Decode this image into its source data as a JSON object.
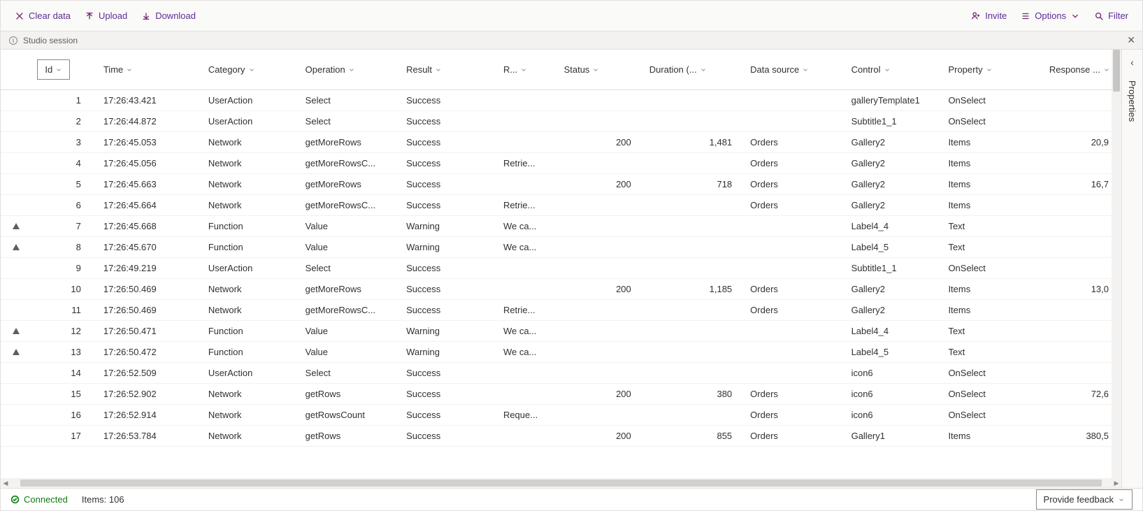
{
  "toolbar": {
    "clear": "Clear data",
    "upload": "Upload",
    "download": "Download",
    "invite": "Invite",
    "options": "Options",
    "filter": "Filter"
  },
  "infobar": {
    "text": "Studio session"
  },
  "sidepanel": {
    "label": "Properties"
  },
  "statusbar": {
    "connected": "Connected",
    "items": "Items: 106",
    "feedback": "Provide feedback"
  },
  "columns": {
    "id": "Id",
    "time": "Time",
    "category": "Category",
    "operation": "Operation",
    "result": "Result",
    "r": "R...",
    "status": "Status",
    "duration": "Duration (...",
    "datasource": "Data source",
    "control": "Control",
    "property": "Property",
    "response": "Response ..."
  },
  "rows": [
    {
      "warn": false,
      "id": "1",
      "time": "17:26:43.421",
      "cat": "UserAction",
      "op": "Select",
      "res": "Success",
      "r": "",
      "status": "",
      "dur": "",
      "ds": "",
      "ctrl": "galleryTemplate1",
      "prop": "OnSelect",
      "resp": ""
    },
    {
      "warn": false,
      "id": "2",
      "time": "17:26:44.872",
      "cat": "UserAction",
      "op": "Select",
      "res": "Success",
      "r": "",
      "status": "",
      "dur": "",
      "ds": "",
      "ctrl": "Subtitle1_1",
      "prop": "OnSelect",
      "resp": ""
    },
    {
      "warn": false,
      "id": "3",
      "time": "17:26:45.053",
      "cat": "Network",
      "op": "getMoreRows",
      "res": "Success",
      "r": "",
      "status": "200",
      "dur": "1,481",
      "ds": "Orders",
      "ctrl": "Gallery2",
      "prop": "Items",
      "resp": "20,9"
    },
    {
      "warn": false,
      "id": "4",
      "time": "17:26:45.056",
      "cat": "Network",
      "op": "getMoreRowsC...",
      "res": "Success",
      "r": "Retrie...",
      "status": "",
      "dur": "",
      "ds": "Orders",
      "ctrl": "Gallery2",
      "prop": "Items",
      "resp": ""
    },
    {
      "warn": false,
      "id": "5",
      "time": "17:26:45.663",
      "cat": "Network",
      "op": "getMoreRows",
      "res": "Success",
      "r": "",
      "status": "200",
      "dur": "718",
      "ds": "Orders",
      "ctrl": "Gallery2",
      "prop": "Items",
      "resp": "16,7"
    },
    {
      "warn": false,
      "id": "6",
      "time": "17:26:45.664",
      "cat": "Network",
      "op": "getMoreRowsC...",
      "res": "Success",
      "r": "Retrie...",
      "status": "",
      "dur": "",
      "ds": "Orders",
      "ctrl": "Gallery2",
      "prop": "Items",
      "resp": ""
    },
    {
      "warn": true,
      "id": "7",
      "time": "17:26:45.668",
      "cat": "Function",
      "op": "Value",
      "res": "Warning",
      "r": "We ca...",
      "status": "",
      "dur": "",
      "ds": "",
      "ctrl": "Label4_4",
      "prop": "Text",
      "resp": ""
    },
    {
      "warn": true,
      "id": "8",
      "time": "17:26:45.670",
      "cat": "Function",
      "op": "Value",
      "res": "Warning",
      "r": "We ca...",
      "status": "",
      "dur": "",
      "ds": "",
      "ctrl": "Label4_5",
      "prop": "Text",
      "resp": ""
    },
    {
      "warn": false,
      "id": "9",
      "time": "17:26:49.219",
      "cat": "UserAction",
      "op": "Select",
      "res": "Success",
      "r": "",
      "status": "",
      "dur": "",
      "ds": "",
      "ctrl": "Subtitle1_1",
      "prop": "OnSelect",
      "resp": ""
    },
    {
      "warn": false,
      "id": "10",
      "time": "17:26:50.469",
      "cat": "Network",
      "op": "getMoreRows",
      "res": "Success",
      "r": "",
      "status": "200",
      "dur": "1,185",
      "ds": "Orders",
      "ctrl": "Gallery2",
      "prop": "Items",
      "resp": "13,0"
    },
    {
      "warn": false,
      "id": "11",
      "time": "17:26:50.469",
      "cat": "Network",
      "op": "getMoreRowsC...",
      "res": "Success",
      "r": "Retrie...",
      "status": "",
      "dur": "",
      "ds": "Orders",
      "ctrl": "Gallery2",
      "prop": "Items",
      "resp": ""
    },
    {
      "warn": true,
      "id": "12",
      "time": "17:26:50.471",
      "cat": "Function",
      "op": "Value",
      "res": "Warning",
      "r": "We ca...",
      "status": "",
      "dur": "",
      "ds": "",
      "ctrl": "Label4_4",
      "prop": "Text",
      "resp": ""
    },
    {
      "warn": true,
      "id": "13",
      "time": "17:26:50.472",
      "cat": "Function",
      "op": "Value",
      "res": "Warning",
      "r": "We ca...",
      "status": "",
      "dur": "",
      "ds": "",
      "ctrl": "Label4_5",
      "prop": "Text",
      "resp": ""
    },
    {
      "warn": false,
      "id": "14",
      "time": "17:26:52.509",
      "cat": "UserAction",
      "op": "Select",
      "res": "Success",
      "r": "",
      "status": "",
      "dur": "",
      "ds": "",
      "ctrl": "icon6",
      "prop": "OnSelect",
      "resp": ""
    },
    {
      "warn": false,
      "id": "15",
      "time": "17:26:52.902",
      "cat": "Network",
      "op": "getRows",
      "res": "Success",
      "r": "",
      "status": "200",
      "dur": "380",
      "ds": "Orders",
      "ctrl": "icon6",
      "prop": "OnSelect",
      "resp": "72,6"
    },
    {
      "warn": false,
      "id": "16",
      "time": "17:26:52.914",
      "cat": "Network",
      "op": "getRowsCount",
      "res": "Success",
      "r": "Reque...",
      "status": "",
      "dur": "",
      "ds": "Orders",
      "ctrl": "icon6",
      "prop": "OnSelect",
      "resp": ""
    },
    {
      "warn": false,
      "id": "17",
      "time": "17:26:53.784",
      "cat": "Network",
      "op": "getRows",
      "res": "Success",
      "r": "",
      "status": "200",
      "dur": "855",
      "ds": "Orders",
      "ctrl": "Gallery1",
      "prop": "Items",
      "resp": "380,5"
    }
  ]
}
